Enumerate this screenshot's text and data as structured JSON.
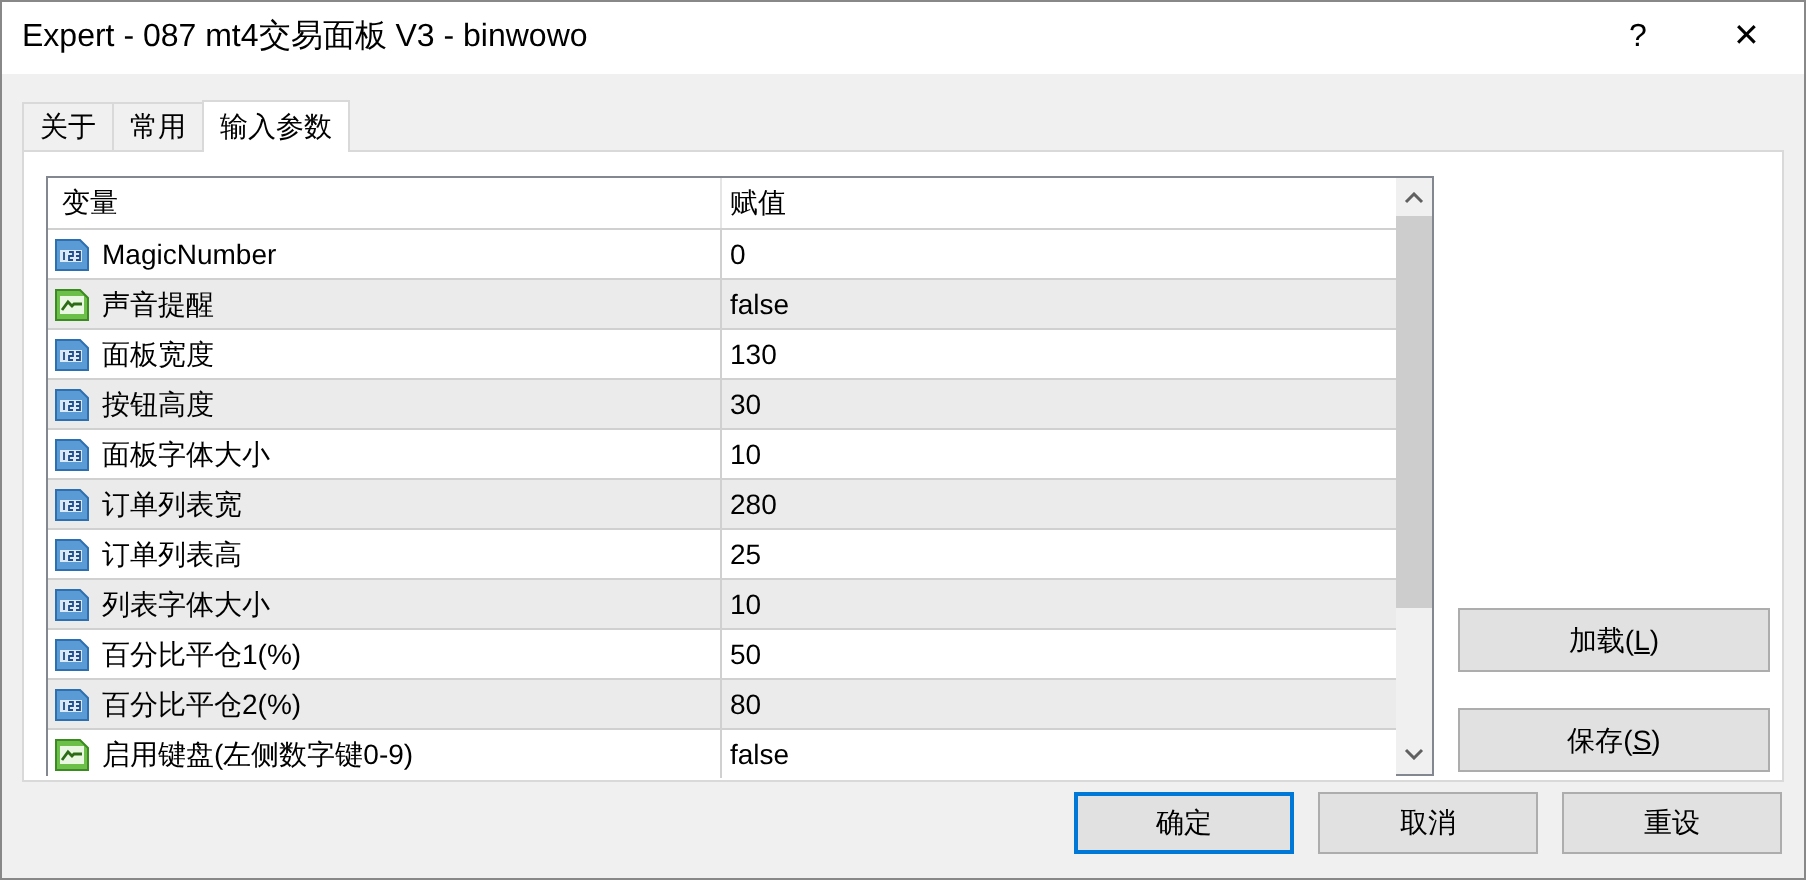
{
  "window": {
    "title": "Expert - 087 mt4交易面板 V3 - binwowo",
    "help": "?",
    "close": "✕"
  },
  "tabs": [
    {
      "label": "关于",
      "selected": false
    },
    {
      "label": "常用",
      "selected": false
    },
    {
      "label": "输入参数",
      "selected": true
    }
  ],
  "table": {
    "columns": [
      "变量",
      "赋值"
    ],
    "rows": [
      {
        "kind": "int",
        "name": "MagicNumber",
        "value": "0"
      },
      {
        "kind": "bool",
        "name": "声音提醒",
        "value": "false"
      },
      {
        "kind": "int",
        "name": "面板宽度",
        "value": "130"
      },
      {
        "kind": "int",
        "name": "按钮高度",
        "value": "30"
      },
      {
        "kind": "int",
        "name": "面板字体大小",
        "value": "10"
      },
      {
        "kind": "int",
        "name": "订单列表宽",
        "value": "280"
      },
      {
        "kind": "int",
        "name": "订单列表高",
        "value": "25"
      },
      {
        "kind": "int",
        "name": "列表字体大小",
        "value": "10"
      },
      {
        "kind": "int",
        "name": "百分比平仓1(%)",
        "value": "50"
      },
      {
        "kind": "int",
        "name": "百分比平仓2(%)",
        "value": "80"
      },
      {
        "kind": "bool",
        "name": "启用键盘(左侧数字键0-9)",
        "value": "false"
      }
    ]
  },
  "side_buttons": [
    {
      "before": "加载(",
      "key": "L",
      "after": ")"
    },
    {
      "before": "保存(",
      "key": "S",
      "after": ")"
    }
  ],
  "buttons": [
    {
      "label": "确定",
      "default": true
    },
    {
      "label": "取消",
      "default": false
    },
    {
      "label": "重设",
      "default": false
    }
  ]
}
